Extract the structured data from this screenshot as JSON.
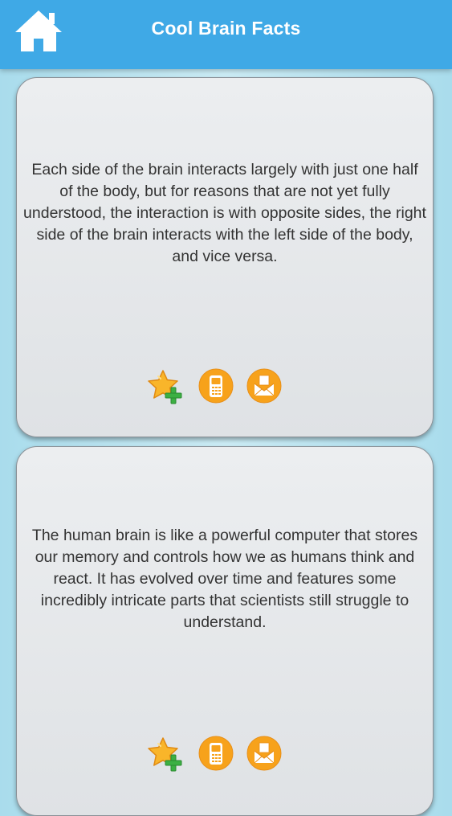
{
  "header": {
    "title": "Cool Brain Facts",
    "home_icon": "home-icon"
  },
  "colors": {
    "header_bg": "#3fa9e6",
    "card_bg": "#e4e7ea",
    "action_orange": "#f7a21b",
    "star_yellow": "#f9b52a",
    "plus_green": "#3cb043",
    "text": "#333333"
  },
  "facts": [
    {
      "text": "Each side of the brain interacts largely with just one half of the body, but for reasons that are not yet fully understood, the interaction is with opposite sides, the right side of the brain interacts with the left side of the body, and vice versa.",
      "actions": [
        "add-favorite-icon",
        "sms-share-icon",
        "email-share-icon"
      ]
    },
    {
      "text": "The human brain is like a powerful computer that stores our memory and controls how we as humans think and react. It has evolved over time and features some incredibly intricate parts that scientists still struggle to understand.",
      "actions": [
        "add-favorite-icon",
        "sms-share-icon",
        "email-share-icon"
      ]
    }
  ]
}
